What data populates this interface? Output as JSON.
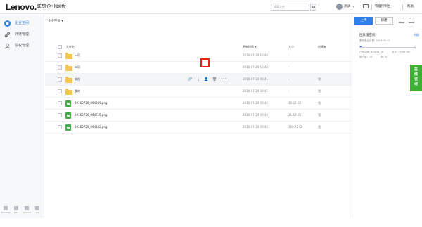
{
  "header": {
    "logo": "Lenovo.",
    "product": "联想企业网盘",
    "search_placeholder": "搜索文件",
    "user": "测试",
    "admin": "管理控制台",
    "help": "帮助"
  },
  "sidebar": {
    "items": [
      {
        "label": "企业空间",
        "icon": "building-icon",
        "active": true
      },
      {
        "label": "外链管理",
        "icon": "link-icon",
        "active": false
      },
      {
        "label": "授权管理",
        "icon": "auth-icon",
        "active": false
      }
    ],
    "bottom": [
      {
        "label": "Windows",
        "icon": "windows-icon"
      },
      {
        "label": "Mac",
        "icon": "mac-icon"
      },
      {
        "label": "Android",
        "icon": "android-icon"
      },
      {
        "label": "iOS",
        "icon": "ios-icon"
      }
    ]
  },
  "main": {
    "breadcrumb": "企业空间 ▾",
    "columns": {
      "name": "文件名",
      "date": "更新时间 ▾",
      "size": "大小",
      "creator": "创建者"
    },
    "rows": [
      {
        "type": "folder",
        "name": "一项",
        "date": "2016-07-20 16:46",
        "size": "-",
        "creator": ""
      },
      {
        "type": "folder",
        "name": "二项",
        "date": "2016-07-20 16:45",
        "size": "-",
        "creator": ""
      },
      {
        "type": "folder",
        "name": "文档",
        "date": "2016-07-20 08:41",
        "size": "-",
        "creator": "我"
      },
      {
        "type": "folder",
        "name": "我的",
        "date": "2016-07-20 08:41",
        "size": "-",
        "creator": "我"
      },
      {
        "type": "image",
        "name": "20160720_094609.png",
        "date": "2016-07-20 09:46",
        "size": "10.42 KB",
        "creator": "我"
      },
      {
        "type": "image",
        "name": "20160720_094615.png",
        "date": "2016-07-20 09:46",
        "size": "21.52 KB",
        "creator": "我"
      },
      {
        "type": "image",
        "name": "20160720_094622.png",
        "date": "2016-07-20 09:46",
        "size": "260.72 KB",
        "creator": "我"
      }
    ],
    "row_actions": {
      "share": "🔗",
      "download": "⤓",
      "authorize": "👤",
      "delete": "🗑",
      "more": "•••"
    }
  },
  "right_panel": {
    "upload": "上传",
    "new": "新建",
    "title": "团队版空间",
    "link": "升级",
    "expire": "服务截止日期: 2016-09-20",
    "used": "已用空间: 400.51 KB",
    "total": "总计: 19.90 GB",
    "users": "用户数: 1/7",
    "remaining": "剩: 6/7",
    "usage_fraction": 0.02
  },
  "consult": "在线咨询",
  "colors": {
    "accent": "#2f80ed",
    "highlight": "#e3231b",
    "green": "#3eb035"
  }
}
